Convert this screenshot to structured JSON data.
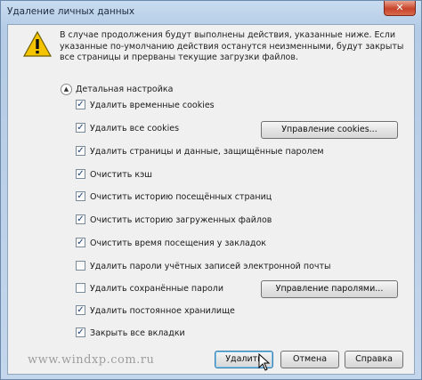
{
  "window": {
    "title": "Удаление личных данных",
    "close_glyph": "✕"
  },
  "warning": {
    "icon": "warning-icon",
    "text": "В случае продолжения будут выполнены действия, указанные ниже. Если указанные по-умолчанию действия останутся неизменными, будут закрыты все страницы и прерваны текущие загрузки файлов."
  },
  "details": {
    "label": "Детальная настройка",
    "expanded": true
  },
  "options": [
    {
      "label": "Удалить временные cookies",
      "checked": true
    },
    {
      "label": "Удалить все cookies",
      "checked": true
    },
    {
      "label": "Удалить страницы и данные, защищённые паролем",
      "checked": true
    },
    {
      "label": "Очистить кэш",
      "checked": true
    },
    {
      "label": "Очистить историю посещённых страниц",
      "checked": true
    },
    {
      "label": "Очистить историю загруженных файлов",
      "checked": true
    },
    {
      "label": "Очистить время посещения у закладок",
      "checked": true
    },
    {
      "label": "Удалить пароли учётных записей электронной почты",
      "checked": false
    },
    {
      "label": "Удалить сохранённые пароли",
      "checked": false
    },
    {
      "label": "Удалить постоянное хранилище",
      "checked": true
    },
    {
      "label": "Закрыть все вкладки",
      "checked": true
    }
  ],
  "buttons": {
    "manage_cookies": "Управление cookies...",
    "manage_passwords": "Управление паролями...",
    "delete": "Удалить",
    "cancel": "Отмена",
    "help": "Справка"
  },
  "watermark": "www.windxp.com.ru"
}
